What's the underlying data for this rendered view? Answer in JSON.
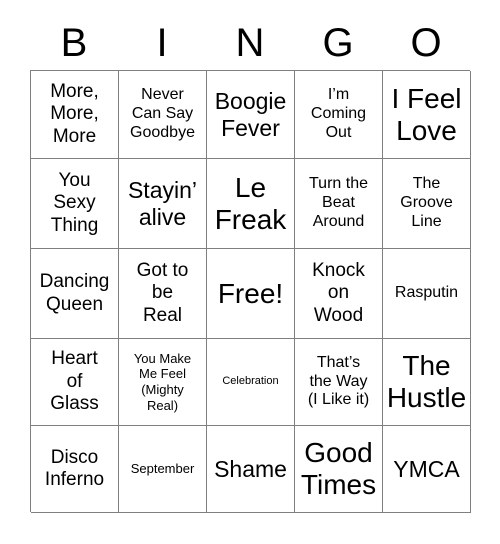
{
  "card": {
    "kind": "bingo-card",
    "columns": 5,
    "rows": 5,
    "header": {
      "letters": [
        "B",
        "I",
        "N",
        "G",
        "O"
      ]
    },
    "colors": {
      "text": "#000000",
      "grid_line": "#808080",
      "background": "#ffffff"
    },
    "cells": [
      [
        {
          "text": "More,\nMore,\nMore",
          "size": "fs-md"
        },
        {
          "text": "Never\nCan Say\nGoodbye",
          "size": "fs-sm"
        },
        {
          "text": "Boogie\nFever",
          "size": "fs-lg"
        },
        {
          "text": "I’m\nComing\nOut",
          "size": "fs-sm"
        },
        {
          "text": "I Feel\nLove",
          "size": "fs-xl"
        }
      ],
      [
        {
          "text": "You\nSexy\nThing",
          "size": "fs-md"
        },
        {
          "text": "Stayin’\nalive",
          "size": "fs-lg"
        },
        {
          "text": "Le\nFreak",
          "size": "fs-xl"
        },
        {
          "text": "Turn the\nBeat\nAround",
          "size": "fs-sm"
        },
        {
          "text": "The\nGroove\nLine",
          "size": "fs-sm"
        }
      ],
      [
        {
          "text": "Dancing\nQueen",
          "size": "fs-md"
        },
        {
          "text": "Got to\nbe\nReal",
          "size": "fs-md"
        },
        {
          "text": "Free!",
          "size": "fs-xl"
        },
        {
          "text": "Knock\non\nWood",
          "size": "fs-md"
        },
        {
          "text": "Rasputin",
          "size": "fs-sm"
        }
      ],
      [
        {
          "text": "Heart\nof\nGlass",
          "size": "fs-md"
        },
        {
          "text": "You Make\nMe Feel\n(Mighty\nReal)",
          "size": "fs-xs"
        },
        {
          "text": "Celebration",
          "size": "fs-xxs"
        },
        {
          "text": "That’s\nthe Way\n(I Like it)",
          "size": "fs-sm"
        },
        {
          "text": "The\nHustle",
          "size": "fs-xl"
        }
      ],
      [
        {
          "text": "Disco\nInferno",
          "size": "fs-md"
        },
        {
          "text": "September",
          "size": "fs-xs"
        },
        {
          "text": "Shame",
          "size": "fs-lg"
        },
        {
          "text": "Good\nTimes",
          "size": "fs-xl"
        },
        {
          "text": "YMCA",
          "size": "fs-lg"
        }
      ]
    ]
  }
}
